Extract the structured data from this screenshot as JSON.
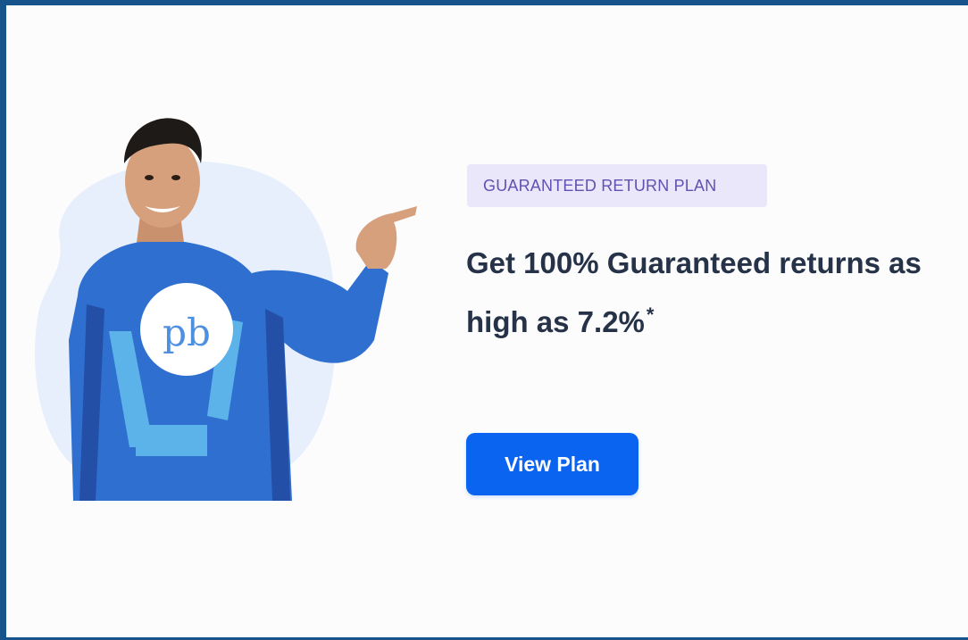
{
  "promo": {
    "tag_label": "GUARANTEED RETURN PLAN",
    "headline_line1": "Get 100% Guaranteed returns as",
    "headline_line2": "high as 7.2%",
    "headline_mark": "*",
    "cta_label": "View Plan",
    "logo_text": "pb"
  },
  "colors": {
    "frame_border": "#17548c",
    "tag_bg": "#ebe7fb",
    "tag_text": "#5f52b2",
    "headline_text": "#253247",
    "cta_bg": "#0a64f0",
    "suit_blue": "#2f6fd0",
    "blob_bg": "#e6effb"
  }
}
